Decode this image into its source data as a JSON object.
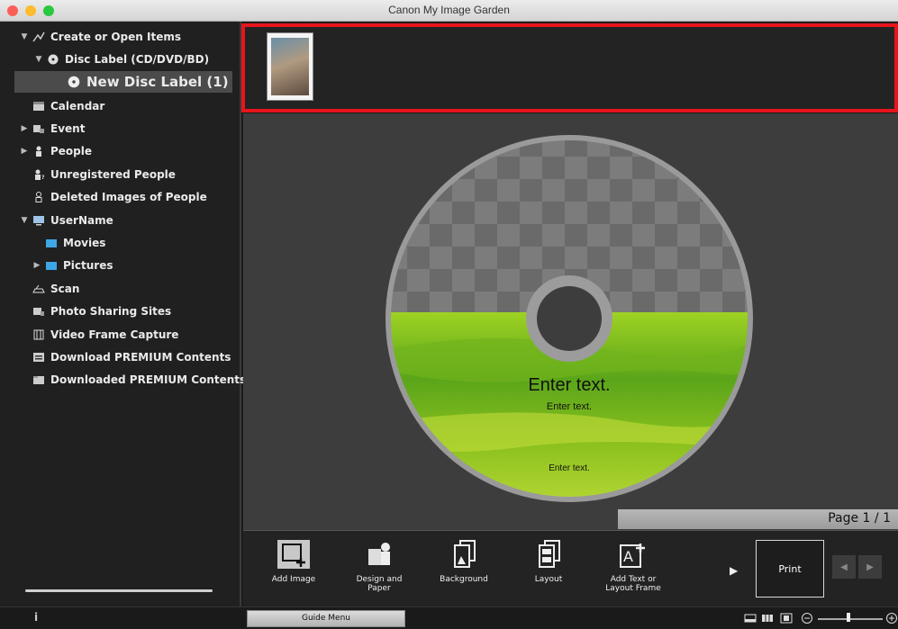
{
  "window": {
    "title": "Canon My Image Garden"
  },
  "sidebar": {
    "items": [
      {
        "label": "Create or Open Items",
        "arrow": "▼",
        "icon": "create-items-icon"
      },
      {
        "label": "Disc Label (CD/DVD/BD)",
        "arrow": "▼",
        "icon": "disc-icon"
      },
      {
        "label": "New Disc Label (1)",
        "arrow": "",
        "icon": "disc-icon",
        "selected": true
      },
      {
        "label": "Calendar",
        "arrow": "",
        "icon": "calendar-icon"
      },
      {
        "label": "Event",
        "arrow": "▶",
        "icon": "event-icon"
      },
      {
        "label": "People",
        "arrow": "▶",
        "icon": "person-icon"
      },
      {
        "label": "Unregistered People",
        "arrow": "",
        "icon": "unregistered-person-icon"
      },
      {
        "label": "Deleted Images of People",
        "arrow": "",
        "icon": "deleted-person-icon"
      },
      {
        "label": "UserName",
        "arrow": "▼",
        "icon": "computer-icon"
      },
      {
        "label": "Movies",
        "arrow": "",
        "icon": "folder-icon"
      },
      {
        "label": "Pictures",
        "arrow": "▶",
        "icon": "folder-icon"
      },
      {
        "label": "Scan",
        "arrow": "",
        "icon": "scan-icon"
      },
      {
        "label": "Photo Sharing Sites",
        "arrow": "",
        "icon": "photo-sharing-icon"
      },
      {
        "label": "Video Frame Capture",
        "arrow": "",
        "icon": "video-frame-icon"
      },
      {
        "label": "Download PREMIUM Contents",
        "arrow": "",
        "icon": "download-icon"
      },
      {
        "label": "Downloaded PREMIUM Contents",
        "arrow": "",
        "icon": "downloaded-folder-icon"
      }
    ]
  },
  "disc": {
    "text_main": "Enter text.",
    "text_sub": "Enter text.",
    "text_bottom": "Enter text."
  },
  "page": {
    "indicator": "Page 1 / 1"
  },
  "toolbar": {
    "tools": [
      {
        "label": "Add Image",
        "icon": "add-image-icon"
      },
      {
        "label": "Design and\nPaper",
        "icon": "design-paper-icon"
      },
      {
        "label": "Background",
        "icon": "background-icon"
      },
      {
        "label": "Layout",
        "icon": "layout-icon"
      },
      {
        "label": "Add Text or\nLayout Frame",
        "icon": "add-text-icon"
      }
    ],
    "print_label": "Print"
  },
  "statusbar": {
    "guide_label": "Guide Menu",
    "info": "i"
  },
  "colors": {
    "highlight": "#e8141b",
    "disc_green": "#8cc21e",
    "sidebar_selected": "#4b4b4b"
  }
}
